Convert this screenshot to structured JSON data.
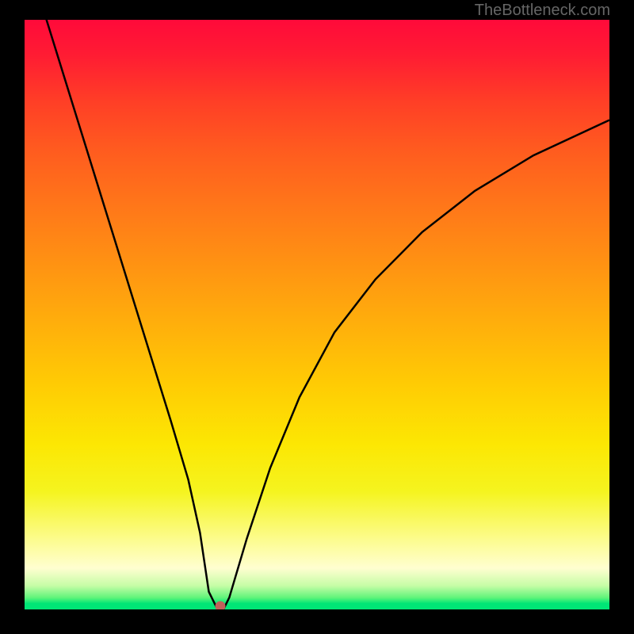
{
  "watermark": "TheBottleneck.com",
  "colors": {
    "curve": "#000000",
    "marker": "#c0605a"
  },
  "chart_data": {
    "type": "line",
    "title": "",
    "xlabel": "",
    "ylabel": "",
    "xlim": [
      0,
      100
    ],
    "ylim": [
      0,
      100
    ],
    "series": [
      {
        "name": "bottleneck-curve",
        "x": [
          0,
          5,
          10,
          15,
          20,
          25,
          28,
          30,
          31.5,
          33,
          34,
          35,
          38,
          42,
          47,
          53,
          60,
          68,
          77,
          87,
          100
        ],
        "y": [
          112,
          96,
          80,
          64,
          48,
          32,
          22,
          13,
          3,
          0,
          0,
          2,
          12,
          24,
          36,
          47,
          56,
          64,
          71,
          77,
          83
        ]
      }
    ],
    "marker": {
      "x": 33.5,
      "y": 0.5
    }
  }
}
